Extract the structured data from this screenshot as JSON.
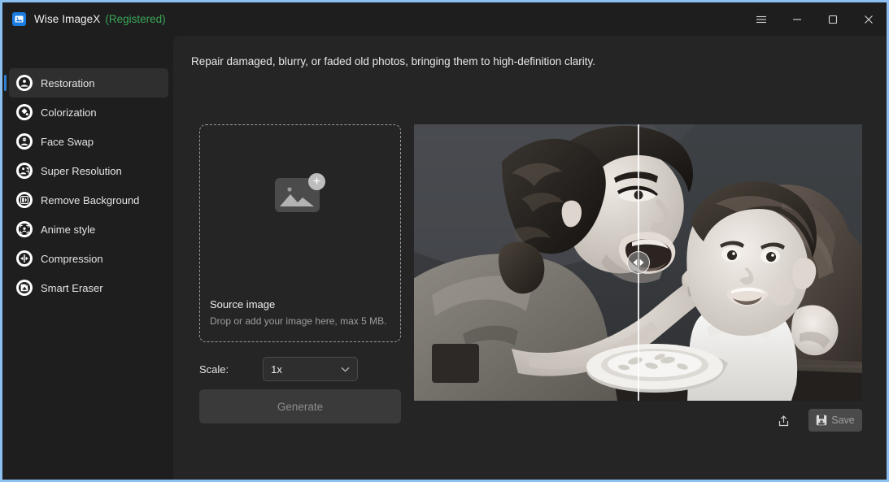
{
  "window": {
    "title": "Wise ImageX",
    "registered_label": "(Registered)",
    "logo_icon": "image-logo-icon",
    "controls": {
      "menu": "hamburger-menu-icon",
      "minimize": "minimize-icon",
      "maximize": "maximize-icon",
      "close": "close-icon"
    },
    "border_color": "#8cc0f0"
  },
  "sidebar": {
    "items": [
      {
        "label": "Restoration",
        "icon": "portrait-restore-icon",
        "active": true
      },
      {
        "label": "Colorization",
        "icon": "paint-drop-icon",
        "active": false
      },
      {
        "label": "Face Swap",
        "icon": "face-swap-icon",
        "active": false
      },
      {
        "label": "Super Resolution",
        "icon": "super-resolution-icon",
        "active": false
      },
      {
        "label": "Remove Background",
        "icon": "remove-background-icon",
        "active": false
      },
      {
        "label": "Anime style",
        "icon": "anime-style-icon",
        "active": false
      },
      {
        "label": "Compression",
        "icon": "compression-icon",
        "active": false
      },
      {
        "label": "Smart Eraser",
        "icon": "smart-eraser-icon",
        "active": false
      }
    ],
    "active_accent_color": "#2f7fd1"
  },
  "main": {
    "description": "Repair damaged, blurry, or faded old photos, bringing them to high-definition clarity.",
    "dropzone": {
      "title": "Source image",
      "subtitle": "Drop or add your image here, max 5 MB.",
      "icon": "add-image-icon",
      "plus_glyph": "+"
    },
    "scale": {
      "label": "Scale:",
      "value": "1x",
      "chevron_icon": "chevron-down-icon"
    },
    "generate": {
      "label": "Generate",
      "enabled": false
    },
    "preview": {
      "alt": "Black and white vintage photo of a woman feeding a baby in a high chair",
      "slider_handle_icon": "compare-slider-icon",
      "divider_position_percent": 50
    },
    "actions": {
      "share_icon": "share-icon",
      "save_label": "Save",
      "save_icon": "save-disk-icon"
    }
  }
}
